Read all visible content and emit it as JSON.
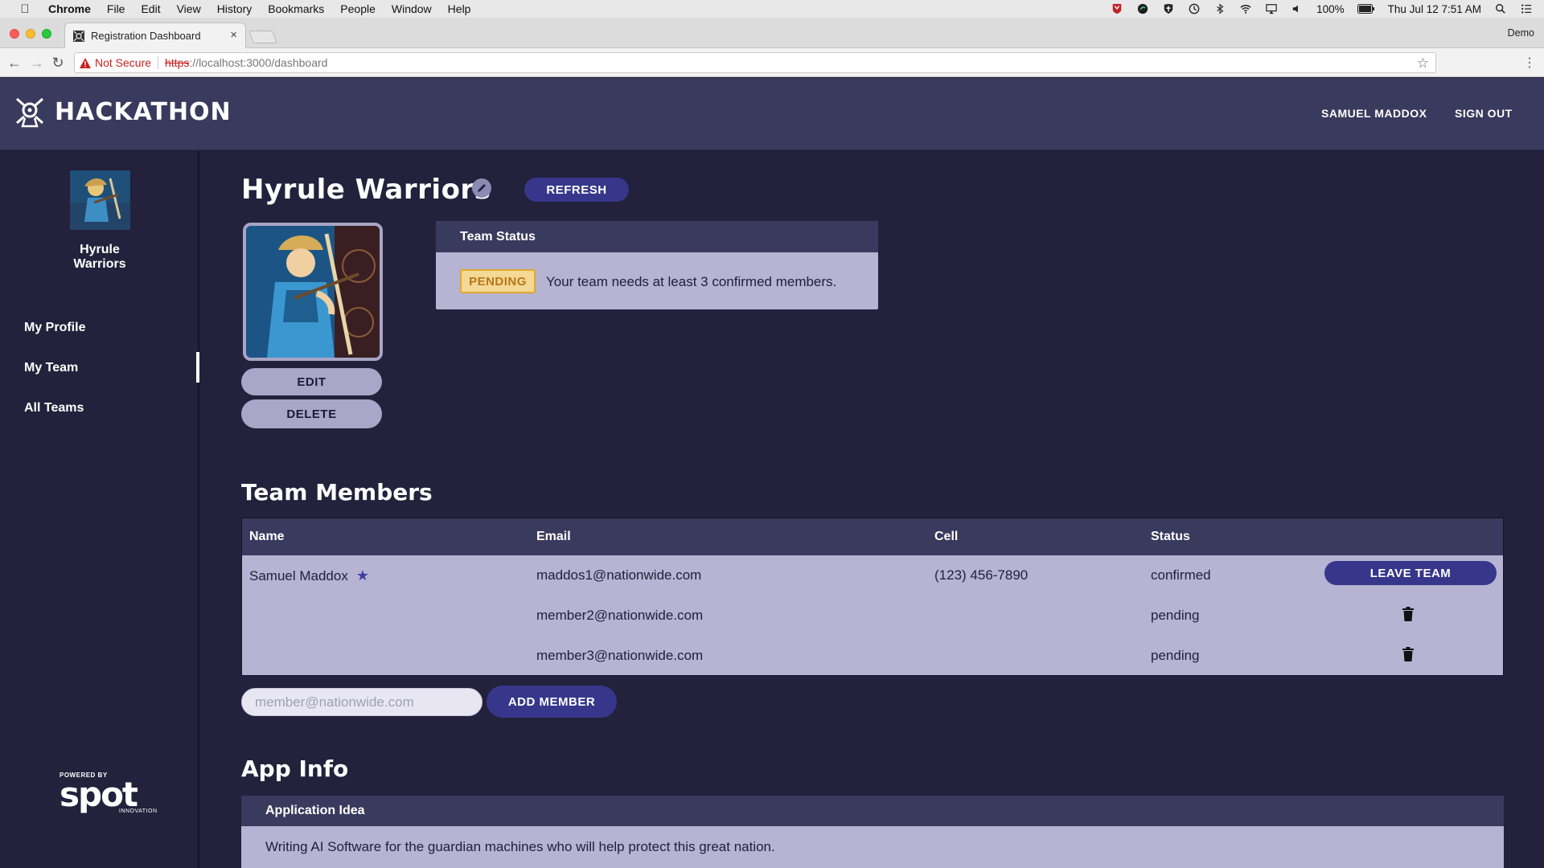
{
  "os_menubar": {
    "app_name": "Chrome",
    "menus": [
      "File",
      "Edit",
      "View",
      "History",
      "Bookmarks",
      "People",
      "Window",
      "Help"
    ],
    "battery": "100%",
    "clock": "Thu Jul 12  7:51 AM"
  },
  "browser": {
    "tab_title": "Registration Dashboard",
    "profile": "Demo",
    "security_label": "Not Secure",
    "url_scheme": "https",
    "url_host": "://localhost:3000",
    "url_path": "/dashboard"
  },
  "header": {
    "logo_text": "HACKATHON",
    "user_name": "SAMUEL MADDOX",
    "sign_out": "SIGN OUT"
  },
  "sidebar": {
    "team_name_line1": "Hyrule",
    "team_name_line2": "Warriors",
    "nav": [
      {
        "label": "My Profile"
      },
      {
        "label": "My Team"
      },
      {
        "label": "All Teams"
      }
    ],
    "powered_by": "POWERED BY",
    "powered_logo": "spot",
    "powered_sub": "INNOVATION"
  },
  "team": {
    "name": "Hyrule Warriors",
    "refresh_label": "REFRESH",
    "edit_photo_label": "EDIT",
    "delete_label": "DELETE"
  },
  "status_card": {
    "title": "Team Status",
    "badge": "PENDING",
    "message": "Your team needs at least 3 confirmed members."
  },
  "members": {
    "section_title": "Team Members",
    "columns": [
      "Name",
      "Email",
      "Cell",
      "Status"
    ],
    "rows": [
      {
        "name": "Samuel Maddox",
        "email": "maddos1@nationwide.com",
        "cell": "(123) 456-7890",
        "status": "confirmed",
        "action": "LEAVE TEAM"
      },
      {
        "name": "",
        "email": "member2@nationwide.com",
        "cell": "",
        "status": "pending"
      },
      {
        "name": "",
        "email": "member3@nationwide.com",
        "cell": "",
        "status": "pending"
      }
    ],
    "add_placeholder": "member@nationwide.com",
    "add_label": "ADD MEMBER"
  },
  "app_info": {
    "section_title": "App Info",
    "card_title": "Application Idea",
    "body": "Writing AI Software for the guardian machines who will help protect this great nation."
  },
  "colors": {
    "page_bg": "#23213b",
    "header_bg": "#3a3a5e",
    "card_bg": "#b6b3d3",
    "primary_button": "#36378a",
    "pending_badge": "#f4d996"
  },
  "icons": [
    "apple-icon",
    "team-logo-icon",
    "edit-pencil-icon",
    "star-icon",
    "trash-icon",
    "warning-icon",
    "bookmark-star-icon"
  ]
}
